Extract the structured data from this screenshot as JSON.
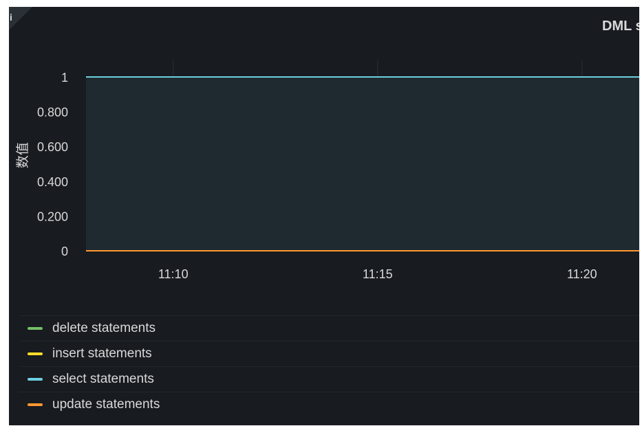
{
  "panel": {
    "title": "DML s",
    "info_glyph": "i"
  },
  "chart_data": {
    "type": "area",
    "ylabel": "数值",
    "ylim": [
      0,
      1
    ],
    "yticks": [
      {
        "value": 0,
        "label": "0"
      },
      {
        "value": 0.2,
        "label": "0.200"
      },
      {
        "value": 0.4,
        "label": "0.400"
      },
      {
        "value": 0.6,
        "label": "0.600"
      },
      {
        "value": 0.8,
        "label": "0.800"
      },
      {
        "value": 1,
        "label": "1"
      }
    ],
    "xlim": [
      "11:07:52",
      "11:21:24"
    ],
    "xticks": [
      {
        "value": "11:10",
        "label": "11:10"
      },
      {
        "value": "11:15",
        "label": "11:15"
      },
      {
        "value": "11:20",
        "label": "11:20"
      }
    ],
    "grid": true,
    "legend_position": "bottom",
    "series": [
      {
        "name": "delete statements",
        "color": "#73bf69",
        "x": [
          "11:07:52",
          "11:21:24"
        ],
        "values": [
          0,
          0
        ]
      },
      {
        "name": "insert statements",
        "color": "#fade2a",
        "x": [
          "11:07:52",
          "11:21:24"
        ],
        "values": [
          0,
          0
        ]
      },
      {
        "name": "select statements",
        "color": "#8ab8ff",
        "line_color": "#6ed0e0",
        "x": [
          "11:07:52",
          "11:21:24"
        ],
        "values": [
          1,
          1
        ]
      },
      {
        "name": "update statements",
        "color": "#ff9830",
        "x": [
          "11:07:52",
          "11:21:24"
        ],
        "values": [
          0,
          0
        ]
      }
    ]
  },
  "legend": {
    "items": [
      {
        "label": "delete statements",
        "color": "#73bf69"
      },
      {
        "label": "insert statements",
        "color": "#fade2a"
      },
      {
        "label": "select statements",
        "color": "#6ed0e0"
      },
      {
        "label": "update statements",
        "color": "#ff9830"
      }
    ]
  },
  "colors": {
    "panel_bg": "#181b1f",
    "grid": "#2c3036",
    "text": "#d8d9da",
    "area_fill": "#1f2a30"
  }
}
